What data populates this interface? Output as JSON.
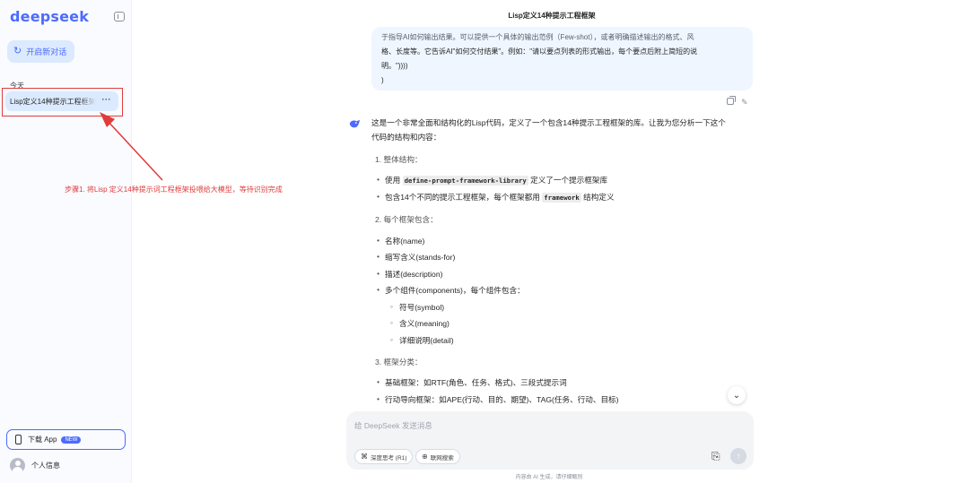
{
  "sidebar": {
    "logo": "deepseek",
    "new_chat_label": "开启新对话",
    "section_today": "今天",
    "conversations": [
      {
        "label": "Lisp定义14种提示工程框架",
        "more": "···"
      }
    ],
    "download_app_label": "下载 App",
    "download_app_badge": "NEW",
    "profile_label": "个人信息"
  },
  "annotation": {
    "text": "步骤1. 将Lisp 定义14种提示词工程框架投喂给大模型，等待识别完成",
    "color": "#e03c3c"
  },
  "chat": {
    "title": "Lisp定义14种提示工程框架",
    "user_message_lines": [
      "于指导AI如何输出结果。可以提供一个具体的输出范例（Few-shot），或者明确描述输出的格式、风",
      "格、长度等。它告诉AI\"如何交付结果\"。例如：\"请以要点列表的形式输出，每个要点后附上简短的说",
      "明。\"))))",
      ")"
    ],
    "answer": {
      "intro_lines": [
        "这是一个非常全面和结构化的Lisp代码，定义了一个包含14种提示工程框架的库。让我为您分析一下这个",
        "代码的结构和内容："
      ],
      "s1_title": "1. 整体结构：",
      "s1_b1_pre": "使用 ",
      "s1_b1_code": "define-prompt-framework-library",
      "s1_b1_post": " 定义了一个提示框架库",
      "s1_b2_pre": "包含14个不同的提示工程框架，每个框架都用 ",
      "s1_b2_code": "framework",
      "s1_b2_post": " 结构定义",
      "s2_title": "2. 每个框架包含：",
      "s2_bullets": [
        "名称(name)",
        "缩写含义(stands-for)",
        "描述(description)",
        "多个组件(components)，每个组件包含："
      ],
      "s2_sub": [
        "符号(symbol)",
        "含义(meaning)",
        "详细说明(detail)"
      ],
      "s3_title": "3. 框架分类：",
      "s3_bullets": [
        "基础框架：如RTF(角色、任务、格式)、三段式提示词",
        "行动导向框架：如APE(行动、目的、期望)、TAG(任务、行动、目标)"
      ]
    }
  },
  "composer": {
    "placeholder": "给 DeepSeek 发送消息",
    "deep_think_label": "深度思考 (R1)",
    "web_search_label": "联网搜索"
  },
  "footer_note": "内容由 AI 生成，请仔细甄别",
  "colors": {
    "brand": "#4d6bfe",
    "selected_bg": "#dbeafe",
    "bubble_bg": "#eff6ff"
  }
}
